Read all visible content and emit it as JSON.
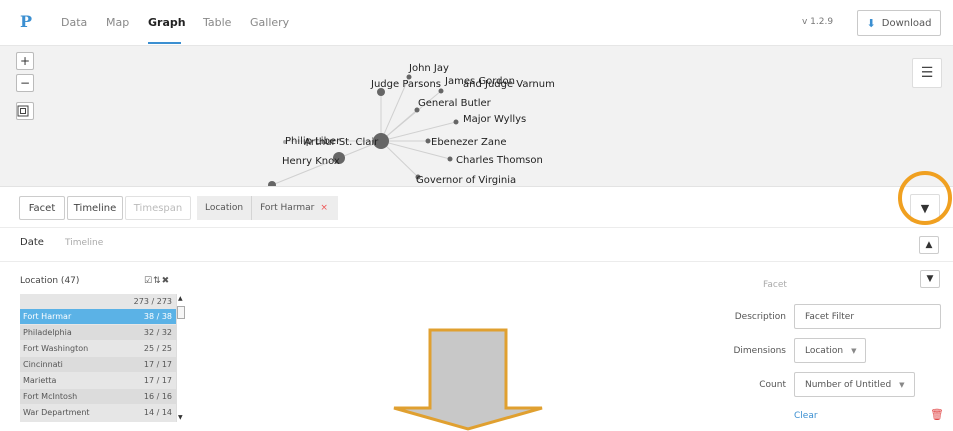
{
  "nav": {
    "logo": "P",
    "links": [
      "Data",
      "Map",
      "Graph",
      "Table",
      "Gallery"
    ],
    "version": "v 1.2.9",
    "download_label": "Download"
  },
  "graph": {
    "zoom_in": "+",
    "zoom_out": "−",
    "fit_icon": "fit-icon",
    "menu_icon": "hamburger-icon",
    "nodes": [
      "John Jay",
      "Judge Parsons",
      "James Gordon",
      "and Judge Varnum",
      "General Butler",
      "Major Wyllys",
      "Philip Liber",
      "Arthur St. Clair",
      "Ebenezer Zane",
      "Charles Thomson",
      "Henry Knox",
      "Governor of Virginia"
    ]
  },
  "filterbar": {
    "facet": "Facet",
    "timeline": "Timeline",
    "timespan": "Timespan",
    "chip_label": "Location",
    "chip_value": "Fort Harmar",
    "chip_remove": "×"
  },
  "date": {
    "title": "Date",
    "subtitle": "Timeline"
  },
  "location": {
    "title": "Location (47)",
    "header_count": "273 / 273",
    "rows": [
      {
        "name": "Fort Harmar",
        "count": "38 / 38"
      },
      {
        "name": "Philadelphia",
        "count": "32 / 32"
      },
      {
        "name": "Fort Washington",
        "count": "25 / 25"
      },
      {
        "name": "Cincinnati",
        "count": "17 / 17"
      },
      {
        "name": "Marietta",
        "count": "17 / 17"
      },
      {
        "name": "Fort McIntosh",
        "count": "16 / 16"
      },
      {
        "name": "War Department",
        "count": "14 / 14"
      }
    ]
  },
  "facet_panel": {
    "title": "Facet",
    "description_label": "Description",
    "description_value": "Facet Filter",
    "dimensions_label": "Dimensions",
    "dimensions_value": "Location",
    "count_label": "Count",
    "count_value": "Number of Untitled",
    "clear": "Clear"
  },
  "colors": {
    "accent": "#3b8fd1",
    "highlight": "#f0a020",
    "selected_row": "#5bb2e6",
    "delete": "#e04545",
    "arrow_fill": "#c8c8c8",
    "arrow_stroke": "#e0a030"
  }
}
